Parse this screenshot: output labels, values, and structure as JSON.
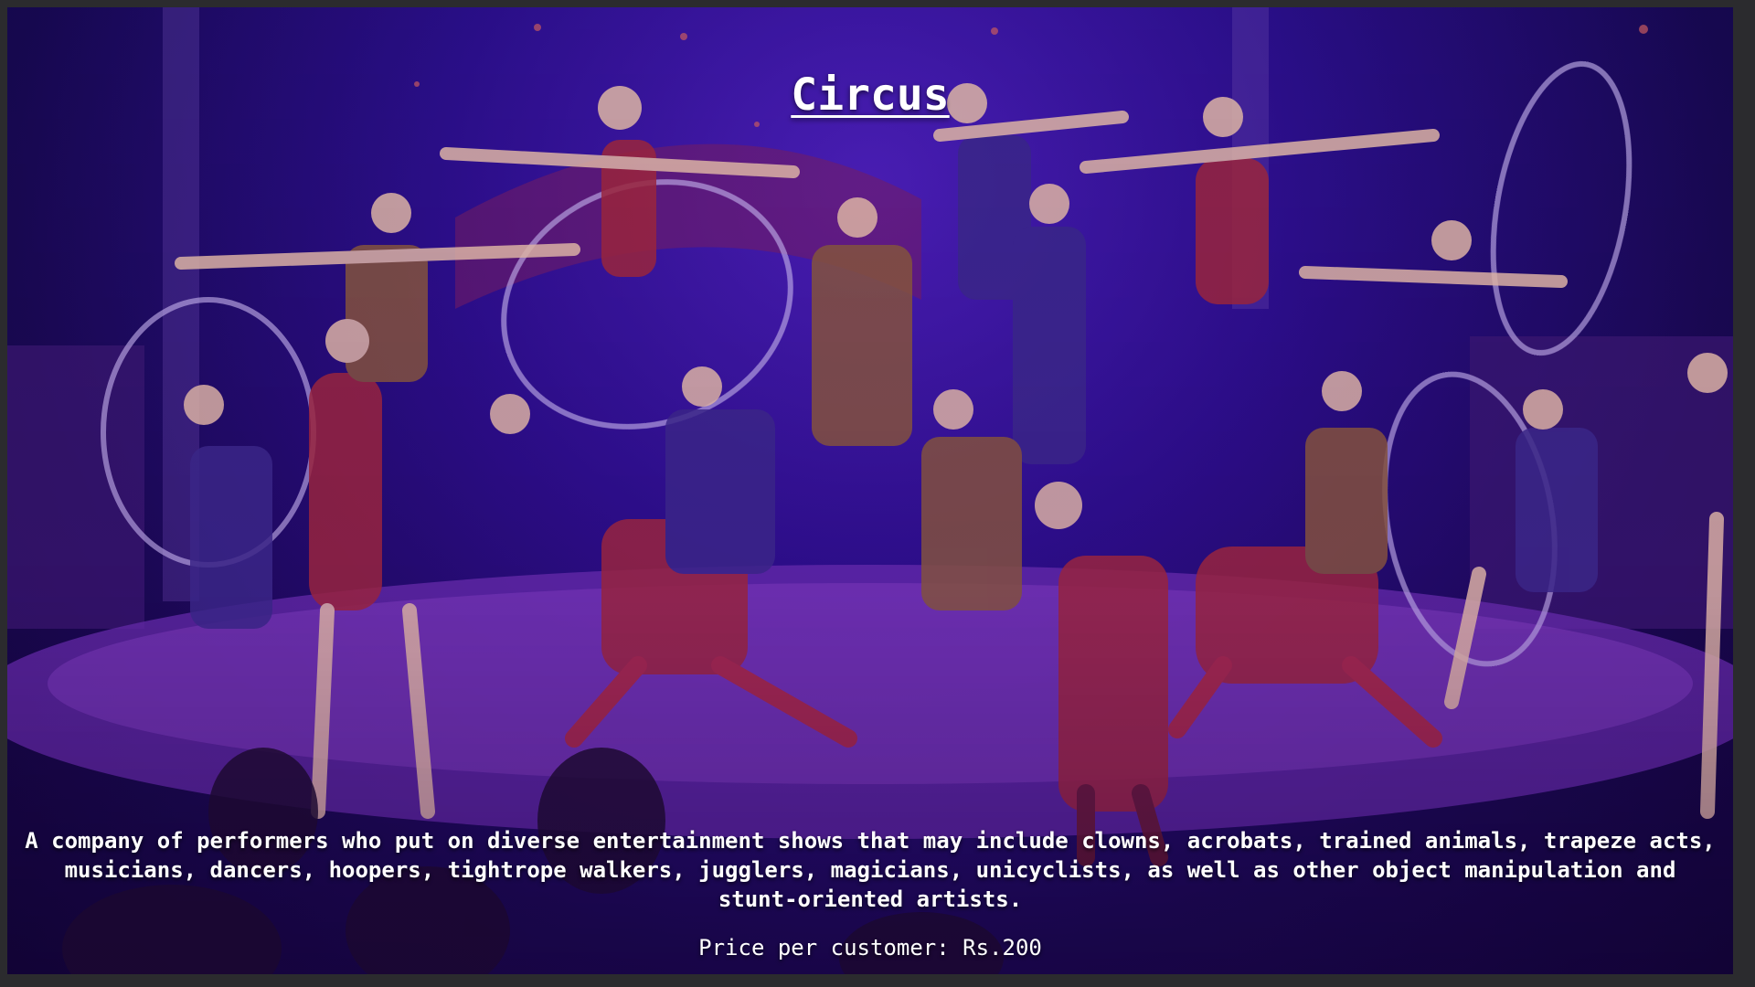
{
  "page": {
    "title": "Circus",
    "description": "A company of performers who put on diverse entertainment shows that may include clowns, acrobats, trained animals, trapeze acts, musicians, dancers, hoopers, tightrope walkers, jugglers, magicians, unicyclists, as well as other object manipulation and stunt-oriented artists.",
    "price": "Price per customer: Rs.200"
  },
  "colors": {
    "tent": "#2a0f8a",
    "stage": "#5a1f9a",
    "text": "#ffffff"
  }
}
